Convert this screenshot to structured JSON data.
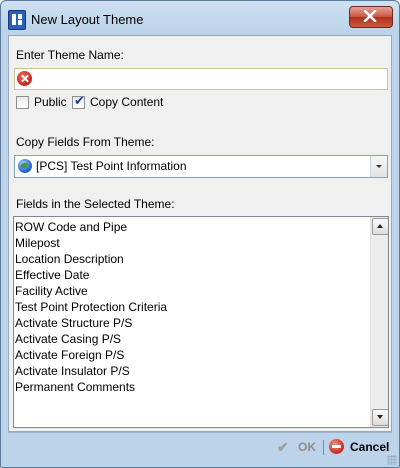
{
  "window": {
    "title": "New Layout Theme"
  },
  "form": {
    "theme_name_label": "Enter Theme Name:",
    "theme_name_value": "",
    "public_label": "Public",
    "public_checked": false,
    "copy_content_label": "Copy Content",
    "copy_content_checked": true,
    "copy_fields_label": "Copy Fields From Theme:",
    "copy_fields_selected": "[PCS] Test Point Information",
    "fields_label": "Fields in the Selected Theme:",
    "fields": [
      "ROW Code and Pipe",
      "Milepost",
      "Location Description",
      "Effective Date",
      "Facility Active",
      "Test Point Protection Criteria",
      "Activate Structure P/S",
      "Activate Casing P/S",
      "Activate Foreign P/S",
      "Activate Insulator P/S",
      "Permanent Comments"
    ]
  },
  "footer": {
    "ok_label": "OK",
    "ok_enabled": false,
    "cancel_label": "Cancel"
  },
  "icons": {
    "app": "layout-theme-icon",
    "close": "close-icon",
    "error": "error-icon",
    "globe": "globe-icon",
    "ok": "checkmark-icon",
    "cancel": "cancel-icon"
  }
}
